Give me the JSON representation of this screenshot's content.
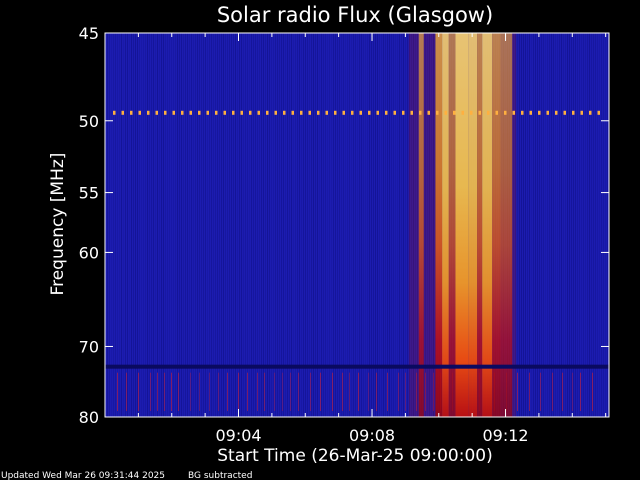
{
  "chart_data": {
    "type": "heatmap",
    "title": "Solar radio Flux (Glasgow)",
    "ylabel": "Frequency [MHz]",
    "xlabel": "Start Time (26-Mar-25 09:00:00)",
    "x_range_minutes": [
      0,
      15.1
    ],
    "x_ticks": [
      {
        "minute": 4,
        "label": "09:04"
      },
      {
        "minute": 8,
        "label": "09:08"
      },
      {
        "minute": 12,
        "label": "09:12"
      }
    ],
    "y_range_mhz": [
      45,
      80
    ],
    "y_scale": "reciprocal",
    "y_ticks": [
      {
        "value": 45,
        "label": "45"
      },
      {
        "value": 50,
        "label": "50"
      },
      {
        "value": 55,
        "label": "55"
      },
      {
        "value": 60,
        "label": "60"
      },
      {
        "value": 70,
        "label": "70"
      },
      {
        "value": 80,
        "label": "80"
      }
    ],
    "background_color": "#1c1cb0",
    "burst_bands": [
      {
        "start_min": 9.4,
        "end_min": 9.55,
        "intensity": 0.55
      },
      {
        "start_min": 9.9,
        "end_min": 10.1,
        "intensity": 0.75
      },
      {
        "start_min": 10.1,
        "end_min": 10.3,
        "intensity": 0.95
      },
      {
        "start_min": 10.3,
        "end_min": 10.5,
        "intensity": 0.5
      },
      {
        "start_min": 10.5,
        "end_min": 10.9,
        "intensity": 1.0
      },
      {
        "start_min": 10.9,
        "end_min": 11.15,
        "intensity": 0.95
      },
      {
        "start_min": 11.15,
        "end_min": 11.3,
        "intensity": 0.6
      },
      {
        "start_min": 11.3,
        "end_min": 11.6,
        "intensity": 0.95
      },
      {
        "start_min": 11.6,
        "end_min": 11.85,
        "intensity": 0.6
      },
      {
        "start_min": 11.85,
        "end_min": 12.2,
        "intensity": 0.45
      }
    ],
    "interference_line_mhz": 49.5,
    "gap_line_mhz": 72.6
  },
  "footer": {
    "updated": "Updated Wed Mar 26 09:31:44 2025",
    "note": "BG subtracted"
  }
}
